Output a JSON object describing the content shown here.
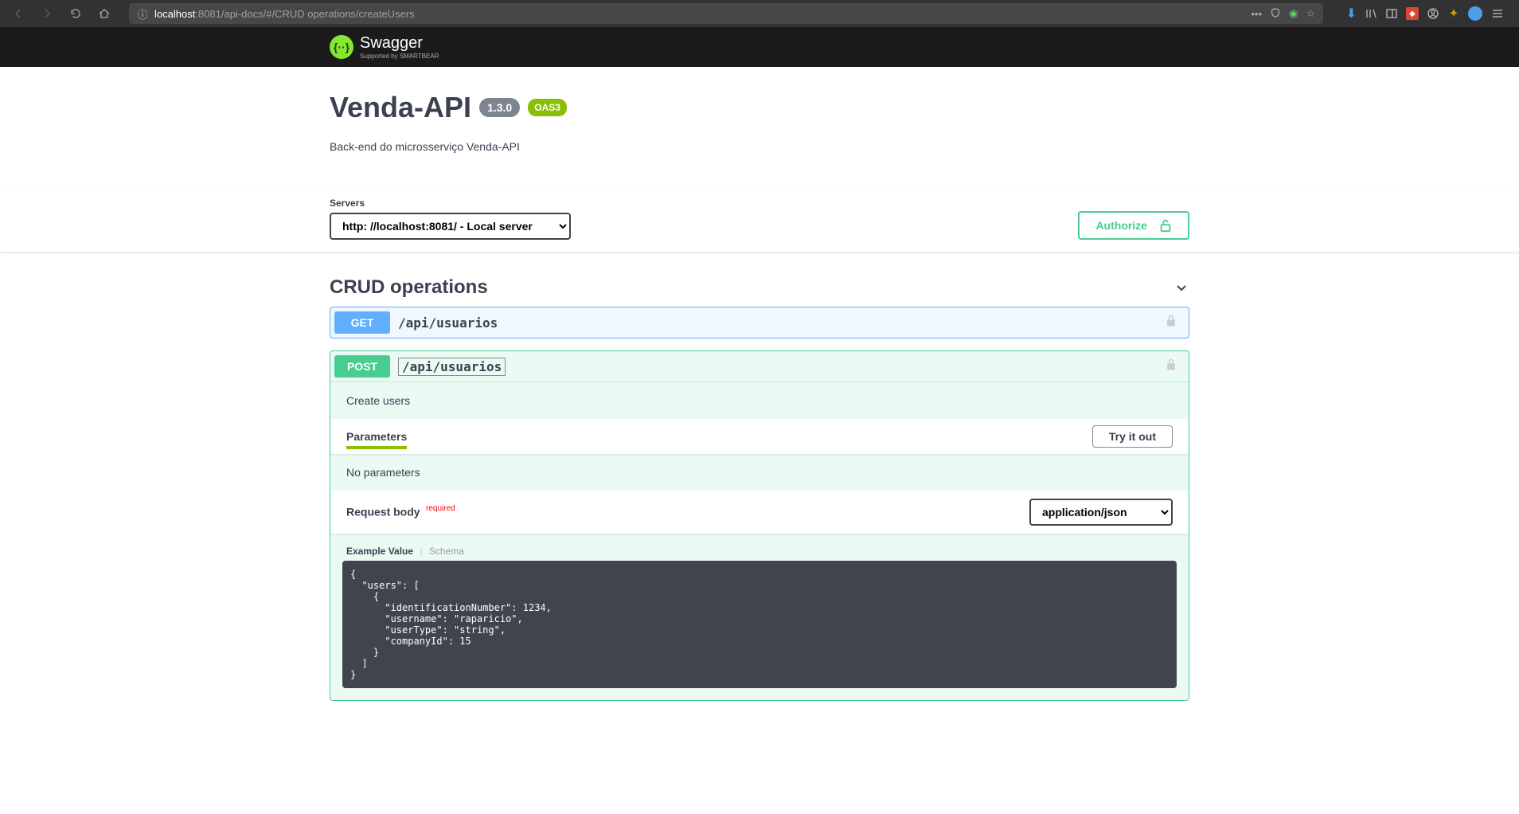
{
  "browser": {
    "url_host": "localhost",
    "url_port": ":8081",
    "url_path": "/api-docs/#/CRUD operations/createUsers"
  },
  "header": {
    "logo_text": "Swagger",
    "logo_sub": "Supported by SMARTBEAR"
  },
  "info": {
    "title": "Venda-API",
    "version": "1.3.0",
    "oas": "OAS3",
    "description": "Back-end do microsserviço Venda-API"
  },
  "servers": {
    "label": "Servers",
    "selected": "http: //localhost:8081/ - Local server"
  },
  "authorize": {
    "label": "Authorize"
  },
  "tag": {
    "name": "CRUD operations"
  },
  "ops": {
    "get": {
      "method": "GET",
      "path": "/api/usuarios"
    },
    "post": {
      "method": "POST",
      "path": "/api/usuarios",
      "description": "Create users",
      "parameters_label": "Parameters",
      "try_it_out": "Try it out",
      "no_parameters": "No parameters",
      "request_body_label": "Request body",
      "required_label": "required",
      "content_type": "application/json",
      "example_tab": "Example Value",
      "schema_tab": "Schema",
      "example_json": "{\n  \"users\": [\n    {\n      \"identificationNumber\": 1234,\n      \"username\": \"raparicio\",\n      \"userType\": \"string\",\n      \"companyId\": 15\n    }\n  ]\n}"
    }
  }
}
